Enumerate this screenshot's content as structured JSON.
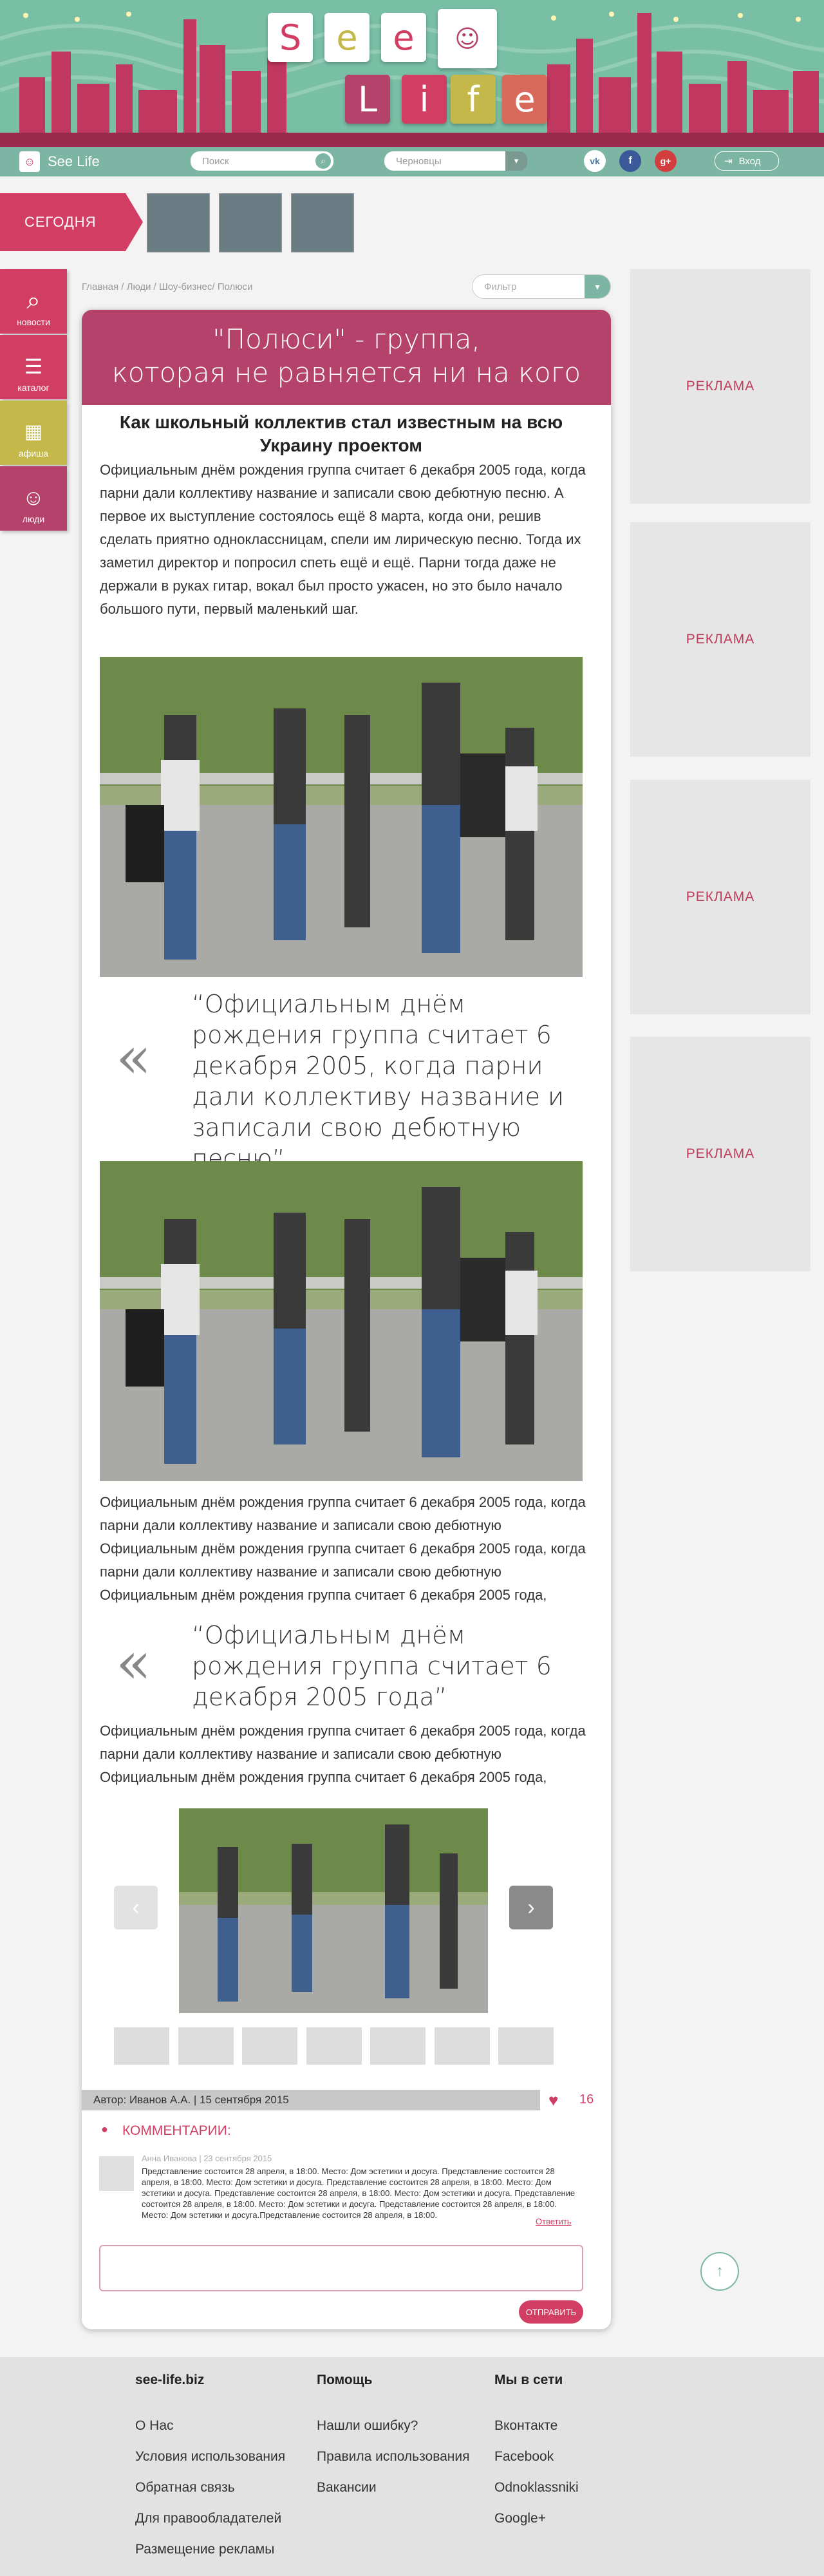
{
  "logo": {
    "letters": [
      "S",
      "e",
      "e",
      "L",
      "i",
      "f",
      "e"
    ]
  },
  "navbar": {
    "site_name": "See Life",
    "search_placeholder": "Поиск",
    "city": "Черновцы",
    "social": [
      "vk",
      "f",
      "g+"
    ],
    "login_label": "Вход"
  },
  "today": {
    "label": "СЕГОДНЯ"
  },
  "left_menu": [
    {
      "label": "новости",
      "icon": "search-icon",
      "color": "#d23e63"
    },
    {
      "label": "каталог",
      "icon": "list-icon",
      "color": "#d23e63"
    },
    {
      "label": "афиша",
      "icon": "calendar-icon",
      "color": "#c4b84a"
    },
    {
      "label": "люди",
      "icon": "person-icon",
      "color": "#b4426b"
    }
  ],
  "breadcrumb": "Главная / Люди / Шоу-бизнес/ Полюси",
  "filter_placeholder": "Фильтр",
  "article": {
    "title_line1": "\"Полюси\" - группа,",
    "title_line2": "которая не равняется ни на кого",
    "subtitle": "Как школьный коллектив стал известным на всю Украину проектом",
    "intro": "Официальным днём рождения группа считает 6 декабря 2005 года, когда парни дали коллективу название и записали свою дебютную песню. А первое их выступление состоялось ещё 8 марта, когда они, решив сделать приятно одноклассницам, спели им лирическую песню. Тогда их заметил директор и попросил спеть ещё и ещё. Парни тогда даже не держали в руках гитар, вокал был просто ужасен, но это было начало большого пути, первый маленький шаг.",
    "quote1": "“Официальным днём рождения группа считает 6 декабря 2005, когда парни дали коллективу название и записали свою дебютную песню”.",
    "para2": "Официальным днём рождения группа считает 6 декабря 2005 года, когда парни дали коллективу название и записали свою дебютную Официальным днём рождения группа считает 6 декабря 2005 года, когда парни дали коллективу название и записали свою дебютную Официальным днём рождения группа считает 6 декабря 2005 года,",
    "quote2": "“Официальным днём рождения группа считает 6 декабря 2005 года”",
    "para3": "Официальным днём рождения группа считает 6 декабря 2005 года, когда парни дали коллективу название и записали свою дебютную Официальным днём рождения группа считает 6 декабря 2005 года,",
    "quote_mark": "«",
    "carousel_prev": "‹",
    "carousel_next": "›",
    "author_line": "Автор: Иванов А.А.  |  15 сентября 2015",
    "likes": "16"
  },
  "comments": {
    "header": "КОММЕНТАРИИ:",
    "items": [
      {
        "meta": "Анна Иванова | 23 сентября 2015",
        "text": "Представление состоится 28 апреля, в 18:00. Место: Дом эстетики и досуга. Представление состоится 28 апреля, в 18:00. Место: Дом эстетики и досуга. Представление состоится 28 апреля, в 18:00. Место: Дом эстетики и досуга. Представление состоится 28 апреля, в 18:00. Место: Дом эстетики и досуга. Представление состоится 28 апреля, в 18:00. Место: Дом эстетики и досуга. Представление состоится 28 апреля, в 18:00. Место: Дом эстетики и досуга.Представление состоится 28 апреля, в 18:00.",
        "reply": "Ответить"
      }
    ],
    "send_label": "ОТПРАВИТЬ"
  },
  "ads": [
    "РЕКЛАМА",
    "РЕКЛАМА",
    "РЕКЛАМА",
    "РЕКЛАМА"
  ],
  "footer": {
    "col1": {
      "title": "see-life.biz",
      "links": [
        "О Нас",
        "Условия использования",
        "Обратная связь",
        "Для правообладателей",
        "Размещение рекламы"
      ]
    },
    "col2": {
      "title": "Помощь",
      "links": [
        "Нашли ошибку?",
        "Правила использования",
        "Вакансии"
      ]
    },
    "col3": {
      "title": "Мы в сети",
      "links": [
        "Вконтакте",
        "Facebook",
        "Odnoklassniki",
        "Google+"
      ]
    }
  },
  "colors": {
    "brand": "#d23e63",
    "plum": "#b4426b",
    "teal": "#7cb5a3",
    "olive": "#c4b84a"
  }
}
